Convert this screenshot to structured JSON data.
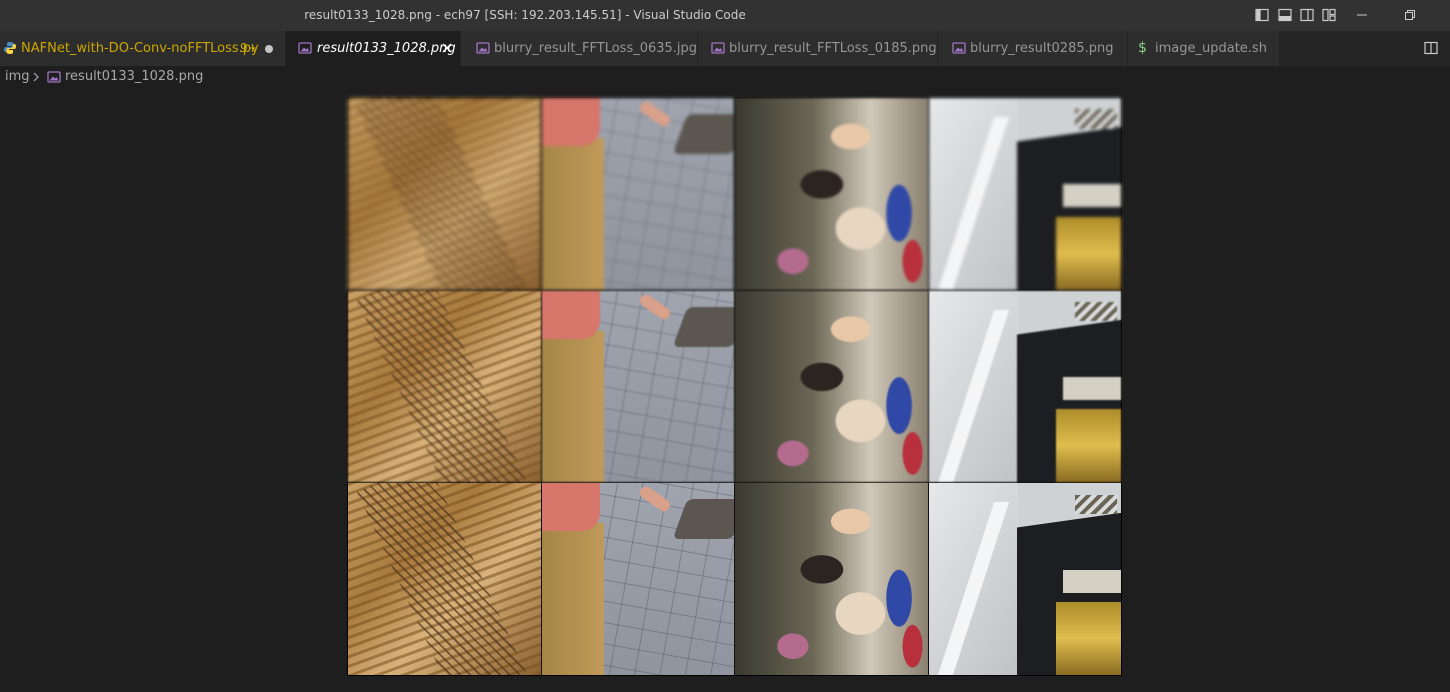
{
  "window": {
    "title": "result0133_1028.png - ech97 [SSH: 192.203.145.51] - Visual Studio Code"
  },
  "tabs": [
    {
      "label": "NAFNet_with-DO-Conv-noFFTLoss.py",
      "badge": "9+",
      "modified": true,
      "icon": "python-icon"
    },
    {
      "label": "result0133_1028.png",
      "active": true,
      "icon": "image-file-icon"
    },
    {
      "label": "blurry_result_FFTLoss_0635.jpg",
      "icon": "image-file-icon"
    },
    {
      "label": "blurry_result_FFTLoss_0185.png",
      "icon": "image-file-icon"
    },
    {
      "label": "blurry_result0285.png",
      "icon": "image-file-icon"
    },
    {
      "label": "image_update.sh",
      "icon": "shell-script-icon",
      "icon_glyph": "$"
    }
  ],
  "breadcrumb": {
    "folder": "img",
    "file": "result0133_1028.png"
  },
  "viewer": {
    "rows": 3,
    "columns": 4
  },
  "colors": {
    "titlebar_bg": "#323233",
    "tabbar_bg": "#252526",
    "editor_bg": "#1e1e1e",
    "modified_accent": "#cca700"
  }
}
